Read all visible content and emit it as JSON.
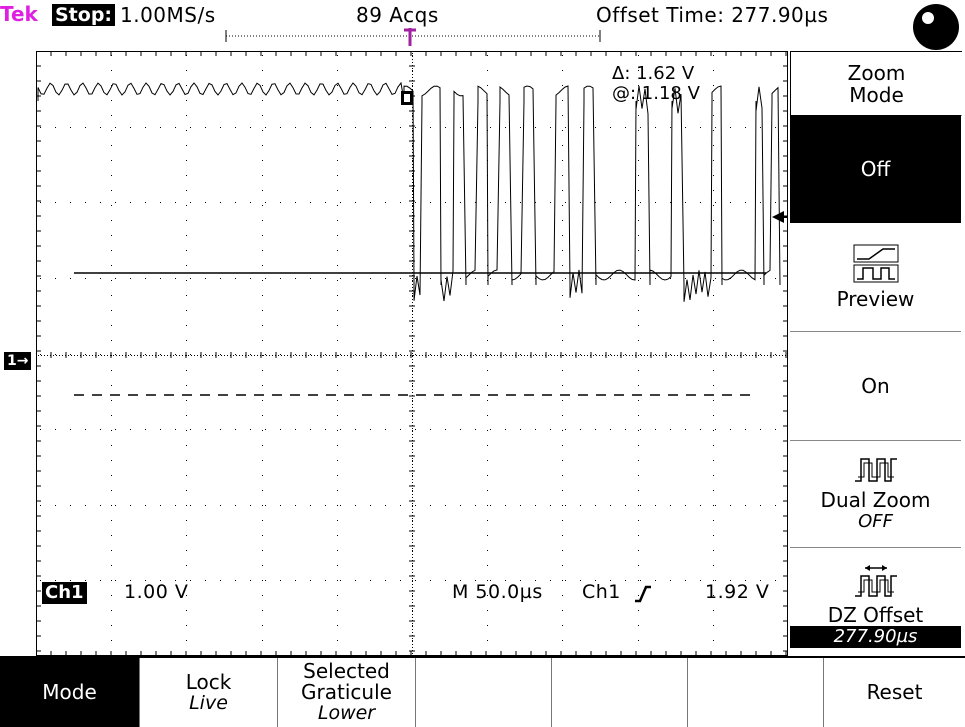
{
  "topbar": {
    "brand": "Tek",
    "state": "Stop:",
    "sample_rate": "1.00MS/s",
    "acquisitions": "89 Acqs",
    "offset_time": "Offset Time: 277.90µs"
  },
  "cursor_readout": {
    "delta": "Δ: 1.62 V",
    "at": "@: 1.18 V"
  },
  "channel": {
    "label": "Ch1",
    "scale": "1.00 V",
    "ground_marker": "1→"
  },
  "trigger": {
    "timebase": "M 50.0µs",
    "source": "Ch1",
    "slope_icon": "rising-edge-icon",
    "level": "1.92 V"
  },
  "side_menu": {
    "zoom_mode": "Zoom Mode",
    "off": "Off",
    "preview": "Preview",
    "on": "On",
    "dual_zoom": "Dual Zoom",
    "dual_zoom_state": "OFF",
    "dz_offset": "DZ Offset",
    "dz_offset_value": "277.90µs"
  },
  "bottom_menu": {
    "mode": "Mode",
    "lock": "Lock",
    "lock_state": "Live",
    "selected_graticule_1": "Selected",
    "selected_graticule_2": "Graticule",
    "selected_graticule_state": "Lower",
    "reset": "Reset"
  },
  "colors": {
    "brand": "#e020e0",
    "trigger_marker": "#a020a0",
    "background": "#ffffff",
    "foreground": "#000000"
  }
}
